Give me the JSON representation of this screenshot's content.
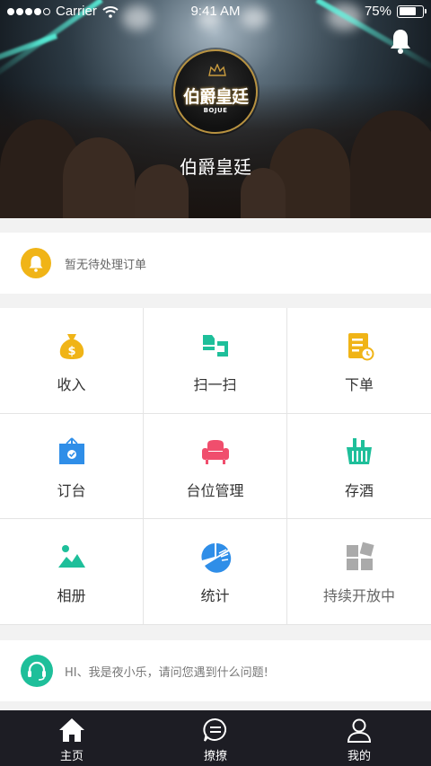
{
  "status_bar": {
    "carrier": "Carrier",
    "time": "9:41 AM",
    "battery": "75%",
    "signal_bars": 4,
    "signal_total": 5
  },
  "header": {
    "logo_text": "伯爵皇廷",
    "logo_subtext": "BOJUE",
    "venue_name": "伯爵皇廷",
    "bell_icon": "bell-icon"
  },
  "notice": {
    "icon": "bell-icon",
    "text": "暂无待处理订单",
    "color": "#f0b417"
  },
  "menu": {
    "items": [
      {
        "label": "收入",
        "icon": "money-bag-icon",
        "color": "#f0b417"
      },
      {
        "label": "扫一扫",
        "icon": "scan-icon",
        "color": "#1ebf9a"
      },
      {
        "label": "下单",
        "icon": "order-icon",
        "color": "#f0b417"
      },
      {
        "label": "订台",
        "icon": "reserve-icon",
        "color": "#2f8ee8"
      },
      {
        "label": "台位管理",
        "icon": "sofa-icon",
        "color": "#f04e6d"
      },
      {
        "label": "存酒",
        "icon": "basket-icon",
        "color": "#1ebf9a"
      },
      {
        "label": "相册",
        "icon": "album-icon",
        "color": "#1ebf9a"
      },
      {
        "label": "统计",
        "icon": "pie-chart-icon",
        "color": "#2f8ee8"
      },
      {
        "label": "持续开放中",
        "icon": "more-icon",
        "color": "#aaaaaa"
      }
    ]
  },
  "chat": {
    "icon": "headset-icon",
    "text": "HI、我是夜小乐，请问您遇到什么问题!",
    "color": "#1ebf9a"
  },
  "tabbar": {
    "tabs": [
      {
        "label": "主页",
        "icon": "home-icon",
        "active": true
      },
      {
        "label": "撩撩",
        "icon": "chat-bubble-icon",
        "active": false
      },
      {
        "label": "我的",
        "icon": "user-icon",
        "active": false
      }
    ]
  }
}
